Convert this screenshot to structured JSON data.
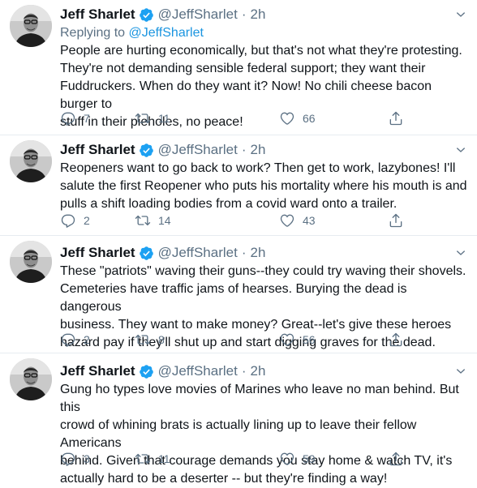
{
  "tweets": [
    {
      "name": "Jeff Sharlet",
      "handle": "@JeffSharlet",
      "dot": "·",
      "time": "2h",
      "replying_label": "Replying to",
      "replying_to": "@JeffSharlet",
      "text": "People are hurting economically, but that's not what they're protesting.\nThey're not demanding sensible federal support; they want their\nFuddruckers. When do they want it? Now! No chili cheese bacon burger to\nstuff in their pieholes, no peace!",
      "replies": "7",
      "retweets": "11",
      "likes": "66"
    },
    {
      "name": "Jeff Sharlet",
      "handle": "@JeffSharlet",
      "dot": "·",
      "time": "2h",
      "text": "Reopeners want to go back to work? Then get to work, lazybones! I'll\nsalute the first Reopener who puts his mortality where his mouth is and\npulls a shift loading bodies from a covid ward onto a trailer.",
      "replies": "2",
      "retweets": "14",
      "likes": "43"
    },
    {
      "name": "Jeff Sharlet",
      "handle": "@JeffSharlet",
      "dot": "·",
      "time": "2h",
      "text": "These \"patriots\" waving their guns--they could try waving their shovels.\nCemeteries have traffic jams of hearses. Burying the dead is dangerous\nbusiness. They want to make money? Great--let's give these heroes\nhazard pay if they'll shut up and start digging graves for the dead.",
      "replies": "2",
      "retweets": "8",
      "likes": "56"
    },
    {
      "name": "Jeff Sharlet",
      "handle": "@JeffSharlet",
      "dot": "·",
      "time": "2h",
      "text": "Gung ho types love movies of Marines who leave no man behind. But this\ncrowd of whining brats is actually lining up to leave their fellow Americans\nbehind. Given that courage demands you stay home & watch TV, it's\nactually hard to be a deserter -- but they're finding a way!",
      "replies": "3",
      "retweets": "11",
      "likes": "59"
    }
  ],
  "colors": {
    "accent": "#1da1f2",
    "secondary_text": "#5b7083",
    "divider": "#e6ecf0"
  },
  "icons": [
    "verified-badge-icon",
    "chevron-down-icon",
    "reply-icon",
    "retweet-icon",
    "like-icon",
    "share-icon"
  ]
}
